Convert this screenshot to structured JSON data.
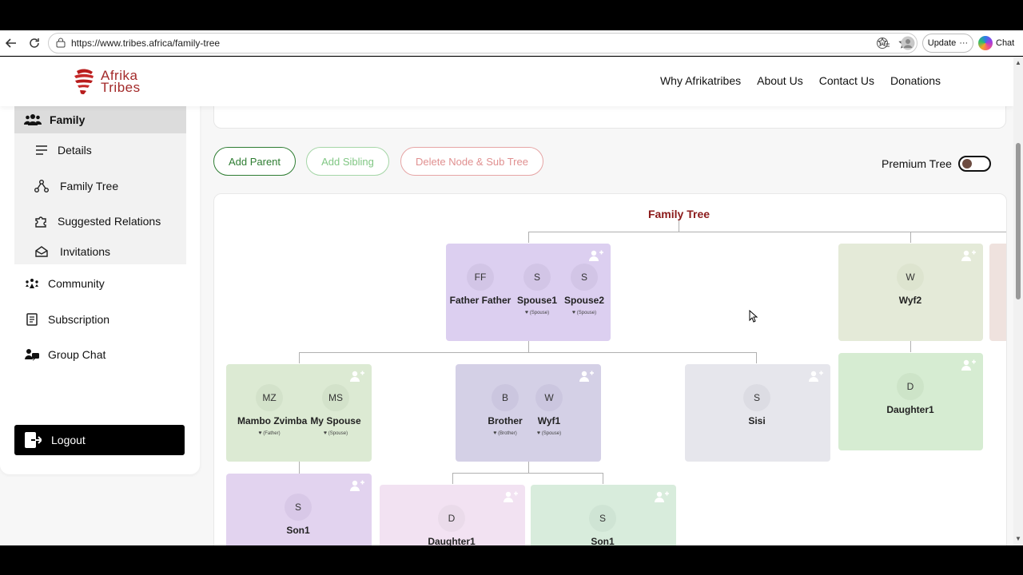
{
  "browser": {
    "url": "https://www.tribes.africa/family-tree",
    "update_label": "Update",
    "chat_label": "Chat"
  },
  "site": {
    "logo_line1": "Afrika",
    "logo_line2": "Tribes",
    "nav": [
      "Why Afrikatribes",
      "About Us",
      "Contact Us",
      "Donations"
    ]
  },
  "sidebar": {
    "family_label": "Family",
    "sub_items": [
      "Details",
      "Family Tree",
      "Suggested Relations",
      "Invitations"
    ],
    "main_items": [
      "Community",
      "Subscription",
      "Group Chat"
    ],
    "logout_label": "Logout"
  },
  "toolbar": {
    "add_parent": "Add Parent",
    "add_sibling": "Add Sibling",
    "delete_node": "Delete Node & Sub Tree",
    "premium_label": "Premium Tree",
    "premium_on": false
  },
  "tree": {
    "title": "Family Tree",
    "nodes": {
      "parents": [
        {
          "initials": "FF",
          "name": "Father Father",
          "role": ""
        },
        {
          "initials": "S",
          "name": "Spouse1",
          "role": "(Spouse)"
        },
        {
          "initials": "S",
          "name": "Spouse2",
          "role": "(Spouse)"
        }
      ],
      "wyf2": [
        {
          "initials": "W",
          "name": "Wyf2",
          "role": ""
        }
      ],
      "mambo": [
        {
          "initials": "MZ",
          "name": "Mambo Zvimba",
          "role": "(Father)"
        },
        {
          "initials": "MS",
          "name": "My Spouse",
          "role": "(Spouse)"
        }
      ],
      "brother": [
        {
          "initials": "B",
          "name": "Brother",
          "role": "(Brother)"
        },
        {
          "initials": "W",
          "name": "Wyf1",
          "role": "(Spouse)"
        }
      ],
      "sisi": [
        {
          "initials": "S",
          "name": "Sisi",
          "role": ""
        }
      ],
      "daughter_right": [
        {
          "initials": "D",
          "name": "Daughter1",
          "role": ""
        }
      ],
      "son_left": [
        {
          "initials": "S",
          "name": "Son1",
          "role": ""
        }
      ],
      "daughter_mid": [
        {
          "initials": "D",
          "name": "Daughter1",
          "role": ""
        }
      ],
      "son_mid": [
        {
          "initials": "S",
          "name": "Son1",
          "role": ""
        }
      ]
    }
  },
  "colors": {
    "brand_red": "#8b1a1a",
    "primary_green": "#2e7d32"
  }
}
